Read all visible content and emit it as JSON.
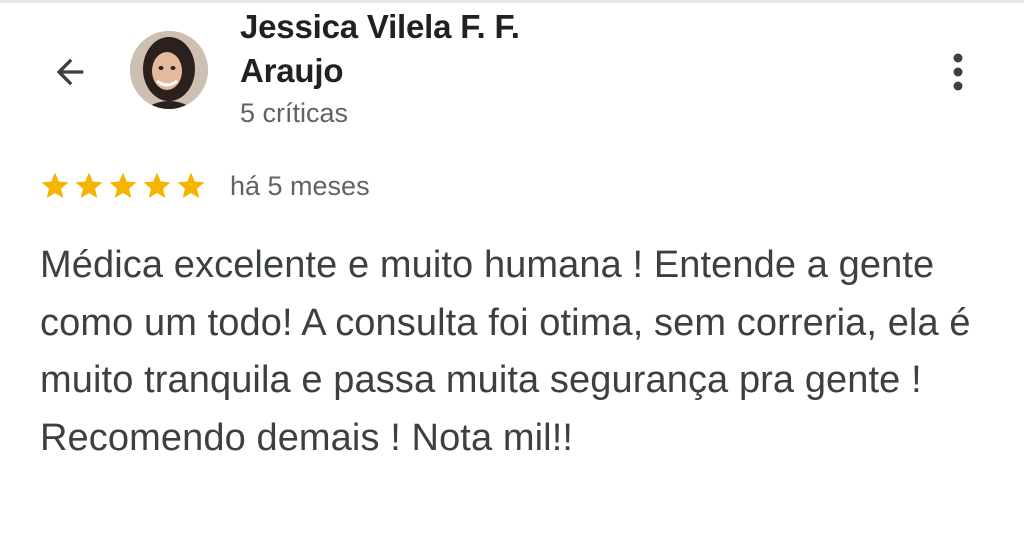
{
  "reviewer": {
    "name": "Jessica Vilela F. F. Araujo",
    "reviews_count": "5 críticas"
  },
  "review": {
    "rating": 5,
    "max_rating": 5,
    "time": "há 5 meses",
    "text": "Médica excelente e muito humana ! Entende a gente como um todo! A consulta foi otima, sem correria, ela é muito tranquila e passa muita segurança pra gente ! Recomendo demais ! Nota mil!!"
  },
  "icons": {
    "back": "arrow-back-icon",
    "more": "more-vert-icon",
    "star": "star-icon"
  },
  "colors": {
    "star": "#F4B400",
    "text_primary": "#202124",
    "text_secondary": "#5f6368",
    "review_text": "#3c4043"
  }
}
